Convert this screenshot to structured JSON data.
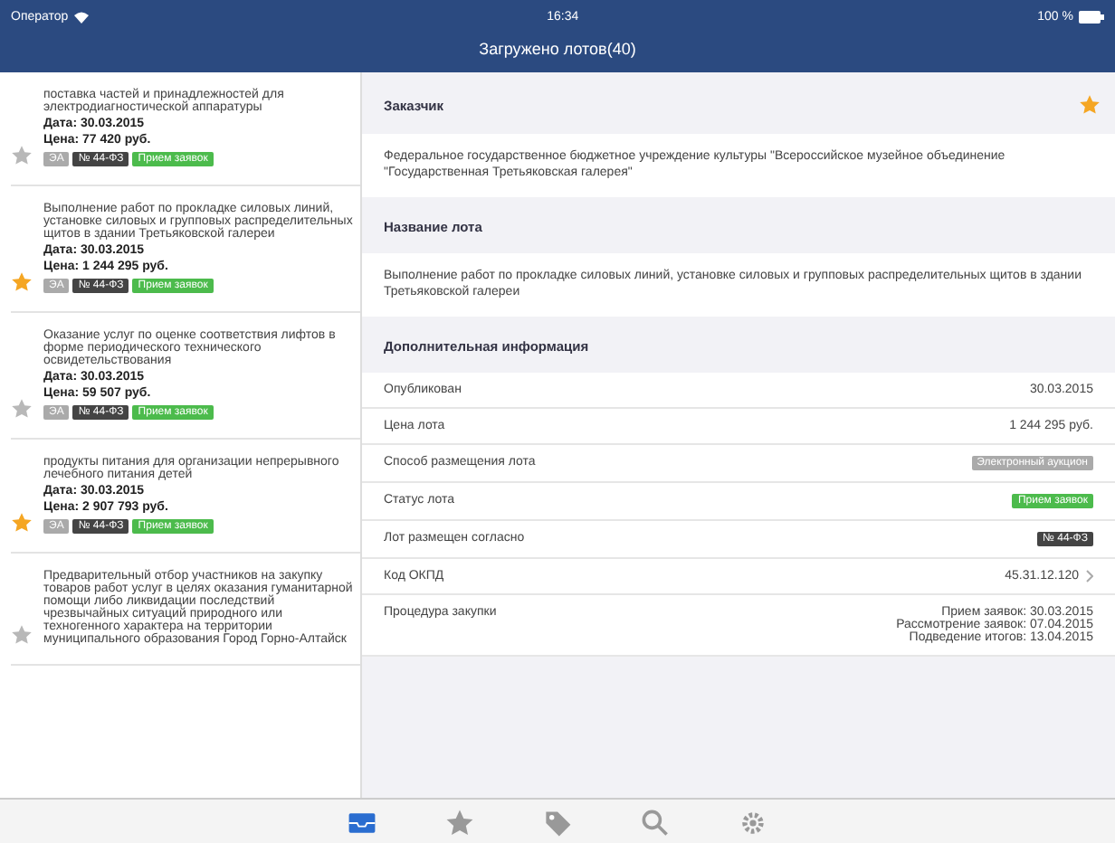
{
  "status_bar": {
    "carrier": "Оператор",
    "time": "16:34",
    "battery": "100 %"
  },
  "window": {
    "title": "Загружено лотов(40)"
  },
  "lots": [
    {
      "text": "поставка частей и принадлежностей для электродиагностической аппаратуры",
      "date": "Дата: 30.03.2015",
      "price": "Цена: 77 420 руб.",
      "starred": false,
      "tags": [
        {
          "kind": "light",
          "text": "ЭА"
        },
        {
          "kind": "dark",
          "text": "№ 44-ФЗ"
        },
        {
          "kind": "green",
          "text": "Прием заявок"
        }
      ]
    },
    {
      "text": "Выполнение работ по прокладке силовых линий, установке силовых и групповых распределительных щитов в здании Третьяковской галереи",
      "date": "Дата: 30.03.2015",
      "price": "Цена: 1 244 295 руб.",
      "starred": true,
      "tags": [
        {
          "kind": "light",
          "text": "ЭА"
        },
        {
          "kind": "dark",
          "text": "№ 44-ФЗ"
        },
        {
          "kind": "green",
          "text": "Прием заявок"
        }
      ]
    },
    {
      "text": "Оказание услуг по оценке соответствия лифтов в форме периодического технического освидетельствования",
      "date": "Дата: 30.03.2015",
      "price": "Цена: 59 507 руб.",
      "starred": false,
      "tags": [
        {
          "kind": "light",
          "text": "ЭА"
        },
        {
          "kind": "dark",
          "text": "№ 44-ФЗ"
        },
        {
          "kind": "green",
          "text": "Прием заявок"
        }
      ]
    },
    {
      "text": "продукты питания для организации непрерывного лечебного питания детей",
      "date": "Дата: 30.03.2015",
      "price": "Цена: 2 907 793 руб.",
      "starred": true,
      "tags": [
        {
          "kind": "light",
          "text": "ЭА"
        },
        {
          "kind": "dark",
          "text": "№ 44-ФЗ"
        },
        {
          "kind": "green",
          "text": "Прием заявок"
        }
      ]
    },
    {
      "text": "Предварительный отбор участников на закупку товаров работ услуг в целях оказания гуманитарной помощи либо ликвидации последствий чрезвычайных ситуаций природного или техногенного характера на территории муниципального образования Город Горно-Алтайск",
      "starred": false
    }
  ],
  "detail": {
    "customer_header": "Заказчик",
    "customer_starred": true,
    "customer": "Федеральное государственное бюджетное учреждение культуры \"Всероссийское музейное объединение \"Государственная Третьяковская галерея\"",
    "lot_header": "Название лота",
    "lot_name": "Выполнение работ по прокладке силовых линий, установке силовых и групповых распределительных щитов в здании Третьяковской галереи",
    "info_header": "Дополнительная информация",
    "rows": [
      {
        "kind": "text",
        "label": "Опубликован",
        "value": "30.03.2015"
      },
      {
        "kind": "text",
        "label": "Цена лота",
        "value": "1 244 295 руб."
      },
      {
        "kind": "light",
        "label": "Способ размещения лота",
        "value": "Электронный аукцион"
      },
      {
        "kind": "green",
        "label": "Статус лота",
        "value": "Прием заявок"
      },
      {
        "kind": "dark",
        "label": "Лот размещен согласно",
        "value": "№ 44-ФЗ"
      },
      {
        "kind": "link",
        "label": "Код ОКПД",
        "value": "45.31.12.120"
      },
      {
        "kind": "lines",
        "label": "Процедура закупки",
        "lines": [
          "Прием заявок: 30.03.2015",
          "Рассмотрение заявок: 07.04.2015",
          "Подведение итогов: 13.04.2015"
        ]
      }
    ]
  },
  "tab_bar": [
    {
      "kind": "tray",
      "selected": true
    },
    {
      "kind": "star",
      "selected": false
    },
    {
      "kind": "tag",
      "selected": false
    },
    {
      "kind": "search",
      "selected": false
    },
    {
      "kind": "gear",
      "selected": false
    }
  ]
}
